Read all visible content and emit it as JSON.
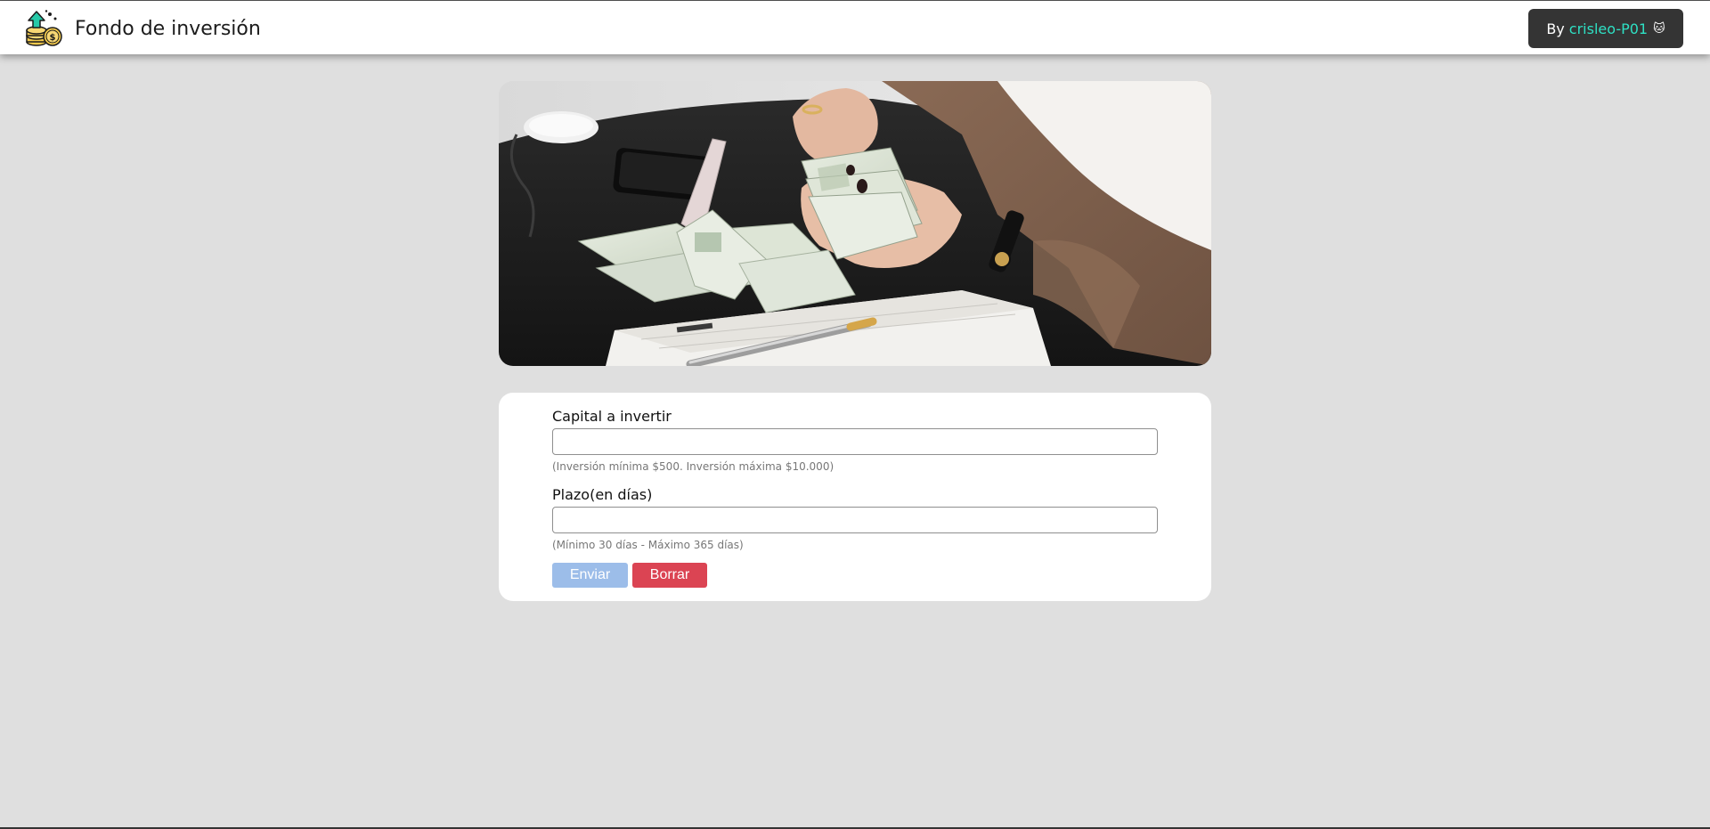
{
  "navbar": {
    "title": "Fondo de inversión",
    "logo_icon": "investment-coins-icon",
    "author_prefix": "By",
    "author_name": "crisleo-P01",
    "author_emoji": "🐱"
  },
  "hero": {
    "image": "hands-counting-dollar-bills-photo"
  },
  "form": {
    "capital": {
      "label": "Capital a invertir",
      "value": "",
      "placeholder": "",
      "help": "(Inversión mínima $500. Inversión máxima $10.000)"
    },
    "term": {
      "label": "Plazo(en días)",
      "value": "",
      "placeholder": "",
      "help": "(Mínimo 30 días - Máximo 365 días)"
    },
    "submit_label": "Enviar",
    "clear_label": "Borrar"
  },
  "colors": {
    "background": "#dfdfdf",
    "navbar": "#ffffff",
    "author_button": "#343434",
    "author_accent": "#2ee0c4",
    "submit_disabled": "#9cbde9",
    "clear_button": "#db4453"
  }
}
